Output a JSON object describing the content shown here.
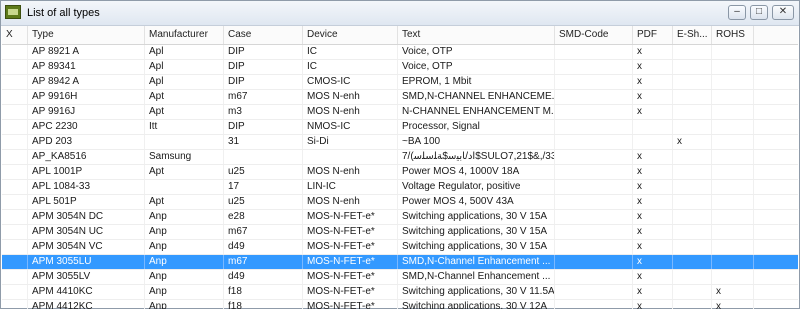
{
  "window": {
    "title": "List of all types"
  },
  "columns": [
    "X",
    "Type",
    "Manufacturer",
    "Case",
    "Device",
    "Text",
    "SMD-Code",
    "PDF",
    "E-Sh...",
    "ROHS"
  ],
  "rows": [
    [
      "",
      "AP 8921 A",
      "Apl",
      "DIP",
      "IC",
      "Voice, OTP",
      "",
      "x",
      "",
      ""
    ],
    [
      "",
      "AP 89341",
      "Apl",
      "DIP",
      "IC",
      "Voice, OTP",
      "",
      "x",
      "",
      ""
    ],
    [
      "",
      "AP 8942 A",
      "Apl",
      "DIP",
      "CMOS-IC",
      "EPROM, 1 Mbit",
      "",
      "x",
      "",
      ""
    ],
    [
      "",
      "AP 9916H",
      "Apt",
      "m67",
      "MOS N-enh",
      "SMD,N-CHANNEL ENHANCEME...",
      "",
      "x",
      "",
      ""
    ],
    [
      "",
      "AP 9916J",
      "Apt",
      "m3",
      "MOS N-enh",
      "N-CHANNEL ENHANCEMENT M...",
      "",
      "x",
      "",
      ""
    ],
    [
      "",
      "APC 2230",
      "Itt",
      "DIP",
      "NMOS-IC",
      "Processor, Signal",
      "",
      "",
      "",
      ""
    ],
    [
      "",
      "APD 203",
      "",
      "31",
      "Si-Di",
      "~BA 100",
      "",
      "",
      "x",
      ""
    ],
    [
      "",
      "AP_KA8516",
      "Samsung",
      "",
      "",
      "7/(ﺍﺩ/ﺎﺑﻴﺳ$ﺔﻠﺳﻠﺳ$SULOﺔﻠﺳ$33/,&$7,21,...",
      "",
      "x",
      "",
      ""
    ],
    [
      "",
      "APL 1001P",
      "Apt",
      "u25",
      "MOS N-enh",
      "Power MOS 4, 1000V 18A",
      "",
      "x",
      "",
      ""
    ],
    [
      "",
      "APL 1084-33",
      "",
      "17",
      "LIN-IC",
      "Voltage Regulator, positive",
      "",
      "x",
      "",
      ""
    ],
    [
      "",
      "APL 501P",
      "Apt",
      "u25",
      "MOS N-enh",
      "Power MOS 4, 500V 43A",
      "",
      "x",
      "",
      ""
    ],
    [
      "",
      "APM 3054N DC",
      "Anp",
      "e28",
      "MOS-N-FET-e*",
      "Switching applications, 30 V 15A",
      "",
      "x",
      "",
      ""
    ],
    [
      "",
      "APM 3054N UC",
      "Anp",
      "m67",
      "MOS-N-FET-e*",
      "Switching applications, 30 V 15A",
      "",
      "x",
      "",
      ""
    ],
    [
      "",
      "APM 3054N VC",
      "Anp",
      "d49",
      "MOS-N-FET-e*",
      "Switching applications, 30 V 15A",
      "",
      "x",
      "",
      ""
    ],
    [
      "",
      "APM 3055LU",
      "Anp",
      "m67",
      "MOS-N-FET-e*",
      "SMD,N-Channel Enhancement ...",
      "",
      "x",
      "",
      ""
    ],
    [
      "",
      "APM 3055LV",
      "Anp",
      "d49",
      "MOS-N-FET-e*",
      "SMD,N-Channel Enhancement ...",
      "",
      "x",
      "",
      ""
    ],
    [
      "",
      "APM 4410KC",
      "Anp",
      "f18",
      "MOS-N-FET-e*",
      "Switching applications, 30 V 11.5A",
      "",
      "x",
      "",
      "x"
    ],
    [
      "",
      "APM 4412KC",
      "Anp",
      "f18",
      "MOS-N-FET-e*",
      "Switching applications, 30 V 12A",
      "",
      "x",
      "",
      "x"
    ]
  ],
  "selected_row": 14
}
